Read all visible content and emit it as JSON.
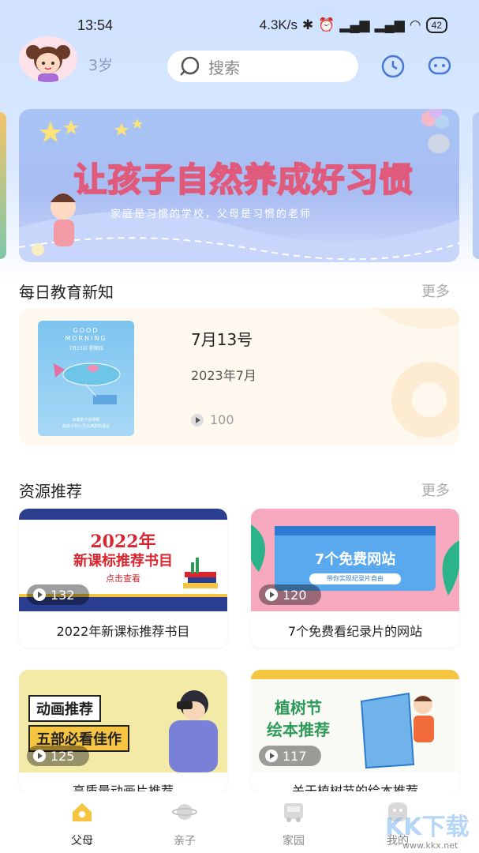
{
  "status_bar": {
    "time": "13:54",
    "net_speed": "4.3K/s",
    "battery": "42"
  },
  "header": {
    "age": "3岁",
    "search_placeholder": "搜索"
  },
  "banner": {
    "title": "让孩子自然养成好习惯",
    "subtitle": "家庭是习惯的学校，父母是习惯的老师"
  },
  "daily": {
    "section_title": "每日教育新知",
    "more": "更多",
    "item": {
      "title": "7月13号",
      "date": "2023年7月",
      "views": "100",
      "thumb_text": {
        "line1": "GOOD",
        "line2": "MORNING",
        "date": "7月13日 星期四",
        "foot1": "未来的不会停歇",
        "foot2": "给孩子的心灵充满爱的语言"
      }
    }
  },
  "resources": {
    "section_title": "资源推荐",
    "more": "更多",
    "items": [
      {
        "title": "2022年新课标推荐书目",
        "views": "132",
        "img_line1": "2022年",
        "img_line2": "新课标推荐书目",
        "img_line3": "点击查看"
      },
      {
        "title": "7个免费看纪录片的网站",
        "views": "120",
        "img_line1": "7个免费网站",
        "img_line2": "带你实现纪录片自由"
      },
      {
        "title": "高质量动画片推荐",
        "views": "125",
        "img_line1": "动画推荐",
        "img_line2": "五部必看佳作"
      },
      {
        "title": "关于植树节的绘本推荐",
        "views": "117",
        "img_line1": "植树节",
        "img_line2": "绘本推荐"
      }
    ]
  },
  "tabbar": {
    "items": [
      {
        "label": "父母",
        "active": true
      },
      {
        "label": "亲子",
        "active": false
      },
      {
        "label": "家园",
        "active": false
      },
      {
        "label": "我的",
        "active": false
      }
    ]
  },
  "watermark": {
    "text": "KK下载",
    "url": "www.kkx.net"
  },
  "colors": {
    "accent": "#f5c542",
    "banner_title_stroke": "#e05a7c",
    "page_bg_top": "#cfe2ff"
  }
}
